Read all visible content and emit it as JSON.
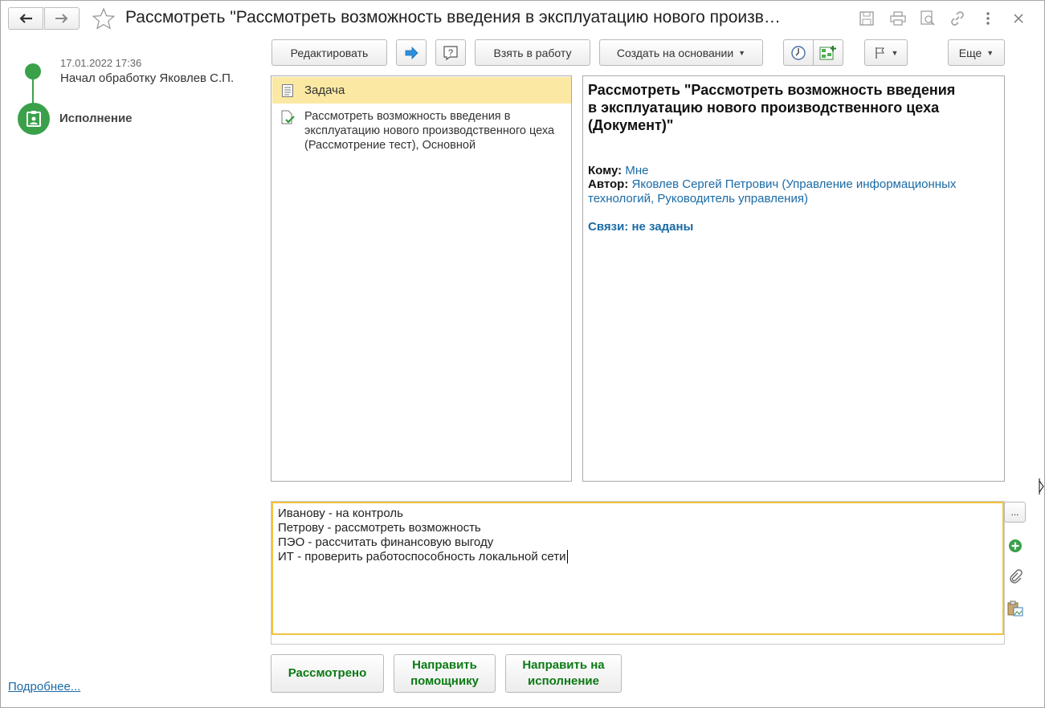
{
  "window": {
    "title": "Рассмотреть \"Рассмотреть возможность введения в эксплуатацию нового произв…"
  },
  "timeline": {
    "date": "17.01.2022 17:36",
    "event": "Начал обработку Яковлев С.П.",
    "current_step": "Исполнение",
    "more_link": "Подробнее..."
  },
  "toolbar": {
    "edit_label": "Редактировать",
    "take_label": "Взять в работу",
    "create_based_label": "Создать на основании",
    "more_label": "Еще"
  },
  "tree": {
    "items": [
      {
        "label": "Задача",
        "icon": "task-list-icon",
        "selected": true
      },
      {
        "label": "Рассмотреть возможность введения в эксплуатацию нового производственного цеха (Рассмотрение тест), Основной",
        "icon": "document-check-icon",
        "selected": false
      }
    ]
  },
  "details": {
    "heading": "Рассмотреть \"Рассмотреть возможность введения в эксплуатацию нового производственного цеха (Документ)\"",
    "to_label": "Кому:",
    "to_value": "Мне",
    "author_label": "Автор:",
    "author_value": "Яковлев Сергей Петрович (Управление информационных технологий, Руководитель управления)",
    "links_text": "Связи: не заданы"
  },
  "comment": {
    "lines": [
      "Иванову - на контроль",
      "Петрову - рассмотреть возможность",
      "ПЭО - рассчитать финансовую выгоду",
      "ИТ - проверить работоспособность локальной сети"
    ],
    "ellipsis_label": "..."
  },
  "actions": {
    "reviewed": "Рассмотрено",
    "to_assistant": "Направить помощнику",
    "to_execution": "Направить на исполнение"
  },
  "colors": {
    "accent_green": "#3aa04a",
    "selected_row": "#fbe9a3",
    "focus_border": "#f2c23d",
    "link_blue": "#1a6aa5",
    "action_green": "#0a7a13"
  }
}
